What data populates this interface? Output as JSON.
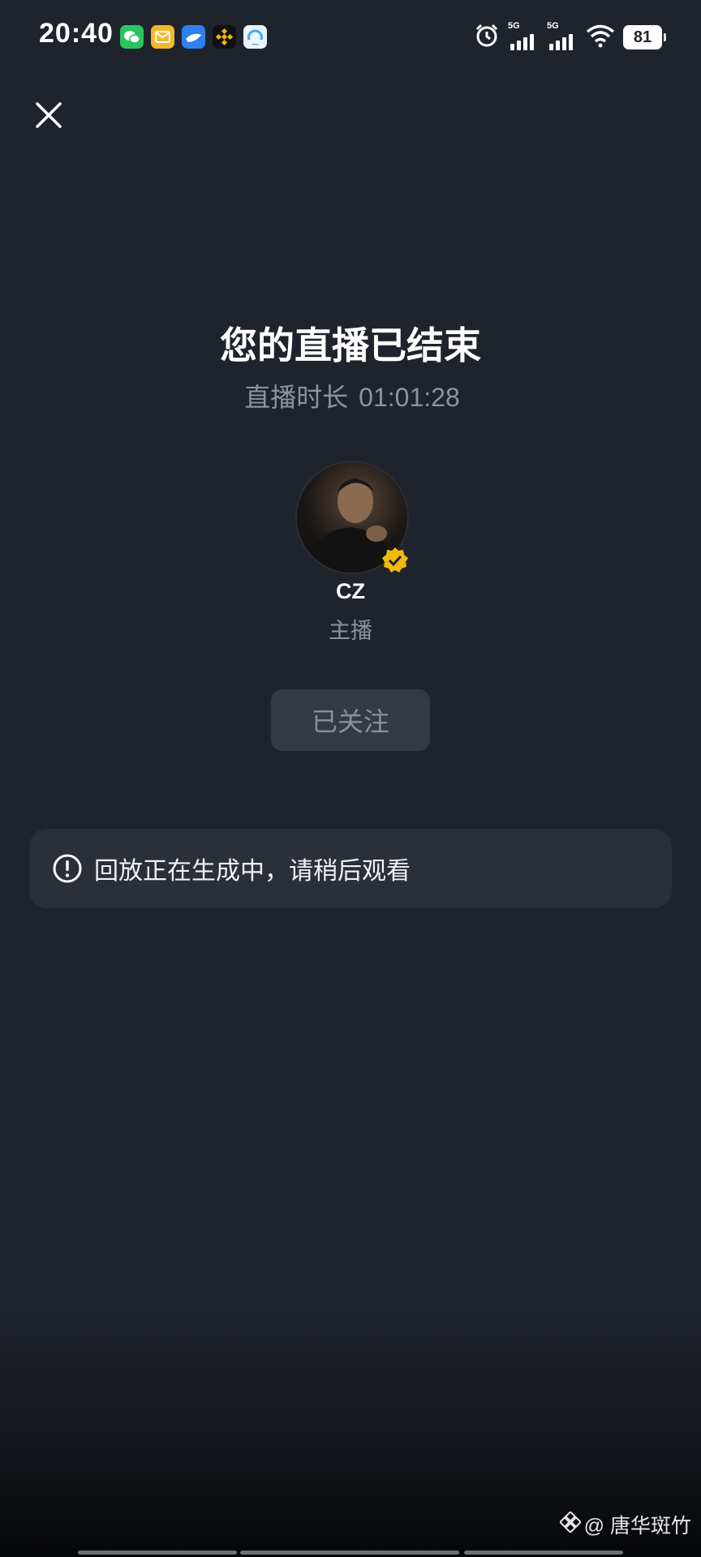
{
  "status_bar": {
    "time": "20:40",
    "app_icons": [
      {
        "name": "wechat-icon",
        "color": "#2dc35e"
      },
      {
        "name": "mail-app-icon",
        "color": "#f3b72b"
      },
      {
        "name": "feishu-icon",
        "color": "#2f80ed"
      },
      {
        "name": "binance-icon",
        "color": "#f0b90b"
      },
      {
        "name": "browser-app-icon",
        "color": "#4aa8f2"
      }
    ],
    "signal_1": "5G",
    "signal_2": "5G",
    "battery": "81"
  },
  "live_end": {
    "title": "您的直播已结束",
    "duration_label": "直播时长",
    "duration_value": "01:01:28"
  },
  "host": {
    "name": "CZ",
    "role": "主播",
    "verified_color": "#f0b90b"
  },
  "follow_button": {
    "label": "已关注"
  },
  "notice": {
    "text": "回放正在生成中，请稍后观看"
  },
  "watermark": {
    "text": "@ 唐华斑竹"
  }
}
